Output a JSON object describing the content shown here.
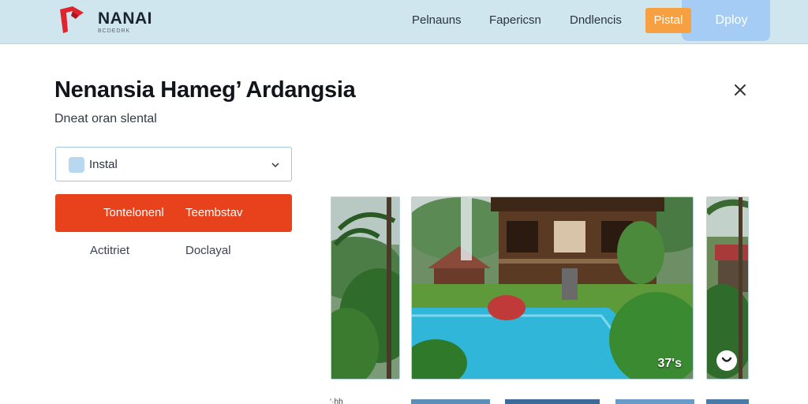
{
  "header": {
    "brand_name": "NANAI",
    "brand_tagline": "BCDEDRK",
    "nav": [
      "Pelnauns",
      "Fapericsn",
      "Dndlencis"
    ],
    "install_label": "Pistal",
    "deploy_label": "Dploy",
    "icons": {
      "logo": "logo-mark-icon"
    }
  },
  "dialog": {
    "title": "Nenansia Hameg’ Ardangsia",
    "subtitle": "Dneat oran slental",
    "select": {
      "value": "Instal",
      "icon": "app-icon"
    },
    "primary_button": {
      "left_label": "Tontelonenl",
      "right_label": "Teembstav"
    },
    "links": [
      "Actitriet",
      "Doclayal"
    ],
    "close_icon": "close-icon"
  },
  "gallery": {
    "photo_count": "37's",
    "partial_caption": "‘·hh",
    "colors": {
      "pool": "#2fb6d8",
      "jungle": "#2f6b2a",
      "house": "#5a3a22"
    }
  },
  "colors": {
    "header_bg": "#cfe6ef",
    "install_bg": "#f7a042",
    "deploy_bg": "#a5ccf4",
    "primary_bg": "#e8421c",
    "select_border": "#9fc6da"
  }
}
